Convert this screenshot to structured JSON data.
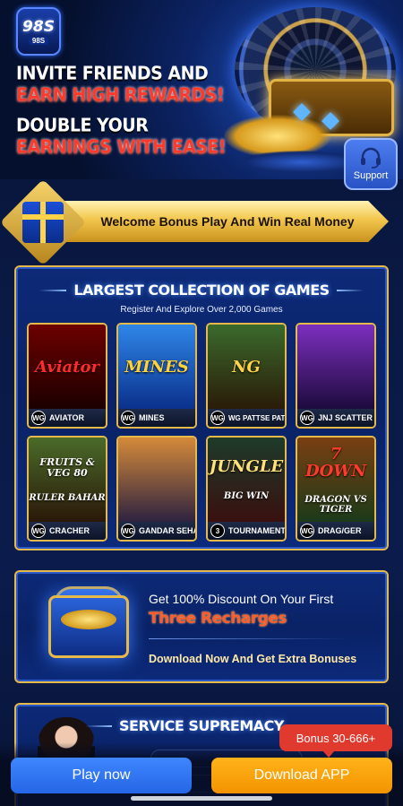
{
  "brand": {
    "logo_text": "98S",
    "logo_sub": "98S"
  },
  "hero": {
    "line1": "INVITE FRIENDS AND",
    "line2": "EARN HIGH REWARDS!",
    "line3": "DOUBLE YOUR",
    "line4": "EARNINGS WITH EASE!"
  },
  "support": {
    "label": "Support",
    "icon": "headset-icon"
  },
  "welcome": {
    "text": "Welcome Bonus Play And Win Real Money",
    "icon": "gift-box-icon"
  },
  "games_section": {
    "title": "LARGEST COLLECTION OF GAMES",
    "subtitle": "Register And Explore Over 2,000 Games",
    "tiles": [
      {
        "badge": "WG",
        "name": "AVIATOR",
        "art": "Aviator",
        "art_sub": "",
        "color_a": "#6d0000",
        "color_b": "#1a0000",
        "art_color": "#ff2b2b"
      },
      {
        "badge": "WG",
        "name": "MINES",
        "art": "MINES",
        "art_sub": "",
        "color_a": "#2f86e8",
        "color_b": "#0a2f8a",
        "art_color": "#ffd23a"
      },
      {
        "badge": "WG",
        "name": "WG PATTSE PATTI",
        "art": "NG",
        "art_sub": "",
        "color_a": "#3b6a2c",
        "color_b": "#2a1a08",
        "art_color": "#ffd34a"
      },
      {
        "badge": "WG",
        "name": "JNJ SCATTER",
        "art": "",
        "art_sub": "",
        "color_a": "#7c2fbf",
        "color_b": "#1b0a3a",
        "art_color": "#ffffff"
      },
      {
        "badge": "WG",
        "name": "CRACHER",
        "art": "FRUITS & VEG 80",
        "art_sub": "RULER BAHAR",
        "color_a": "#4a6b2a",
        "color_b": "#2a1608",
        "art_color": "#ffffff"
      },
      {
        "badge": "WG",
        "name": "GANDAR SEHAR",
        "art": "",
        "art_sub": "",
        "color_a": "#d58a3a",
        "color_b": "#2a2040",
        "art_color": "#ffffff"
      },
      {
        "badge": "3",
        "name": "TOURNAMENT",
        "art": "JUNGLE",
        "art_sub": "BIG WIN",
        "color_a": "#1d3b2a",
        "color_b": "#3a0f0f",
        "art_color": "#ffe27a"
      },
      {
        "badge": "WG",
        "name": "DRAG/GER",
        "art": "7 DOWN",
        "art_sub": "DRAGON VS TIGER",
        "color_a": "#7a3f12",
        "color_b": "#1a3a1a",
        "art_color": "#ff3a2a"
      }
    ]
  },
  "discount": {
    "line1": "Get 100% Discount On Your First",
    "line2": "Three Recharges",
    "line3": "Download Now And Get Extra Bonuses",
    "icon": "treasure-chest-icon"
  },
  "service": {
    "title": "SERVICE SUPREMACY"
  },
  "bottom": {
    "play_label": "Play now",
    "download_label": "Download APP",
    "bonus_badge": "Bonus 30-666+"
  },
  "colors": {
    "gold": "#e5b94a",
    "panel_blue": "#0d2a78",
    "play_blue": "#2f75ff",
    "download_orange": "#f7a10c",
    "badge_red": "#e03a2f"
  }
}
